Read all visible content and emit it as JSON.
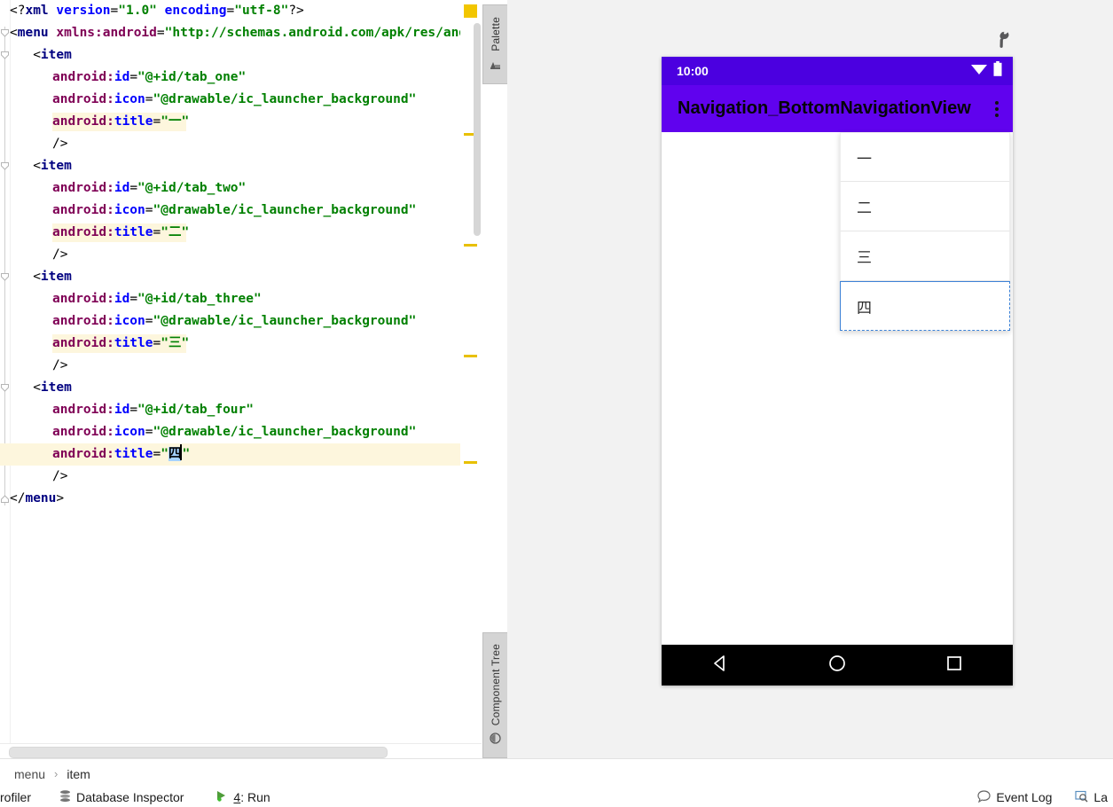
{
  "editor": {
    "lines": [
      {
        "id": "l1",
        "tokens": [
          {
            "t": "punc",
            "s": "<?"
          },
          {
            "t": "proc",
            "s": "xml"
          },
          {
            "t": "punc",
            "s": " "
          },
          {
            "t": "attr2",
            "s": "version"
          },
          {
            "t": "punc",
            "s": "="
          },
          {
            "t": "val",
            "s": "\"1.0\""
          },
          {
            "t": "punc",
            "s": " "
          },
          {
            "t": "attr2",
            "s": "encoding"
          },
          {
            "t": "punc",
            "s": "="
          },
          {
            "t": "val",
            "s": "\"utf-8\""
          },
          {
            "t": "punc",
            "s": "?>"
          }
        ],
        "indent": 0,
        "highlight": false
      },
      {
        "id": "l2",
        "tokens": [
          {
            "t": "punc",
            "s": "<"
          },
          {
            "t": "tag",
            "s": "menu"
          },
          {
            "t": "punc",
            "s": " "
          },
          {
            "t": "attr",
            "s": "xmlns:android"
          },
          {
            "t": "punc",
            "s": "="
          },
          {
            "t": "val",
            "s": "\"http://schemas.android.com/apk/res/and"
          }
        ],
        "indent": 0,
        "highlight": false
      },
      {
        "id": "l3",
        "tokens": [
          {
            "t": "punc",
            "s": "<"
          },
          {
            "t": "tag",
            "s": "item"
          }
        ],
        "indent": 3,
        "highlight": false
      },
      {
        "id": "l4",
        "tokens": [
          {
            "t": "attr",
            "s": "android:"
          },
          {
            "t": "attr2",
            "s": "id"
          },
          {
            "t": "punc",
            "s": "="
          },
          {
            "t": "val",
            "s": "\"@+id/tab_one\""
          }
        ],
        "indent": 5.5,
        "highlight": false
      },
      {
        "id": "l5",
        "tokens": [
          {
            "t": "attr",
            "s": "android:"
          },
          {
            "t": "attr2",
            "s": "icon"
          },
          {
            "t": "punc",
            "s": "="
          },
          {
            "t": "val",
            "s": "\"@drawable/ic_launcher_background\""
          }
        ],
        "indent": 5.5,
        "highlight": false
      },
      {
        "id": "l6",
        "tokens": [
          {
            "t": "attr",
            "s": "android:"
          },
          {
            "t": "attr2",
            "s": "title"
          },
          {
            "t": "punc",
            "s": "="
          },
          {
            "t": "val",
            "s": "\"一\""
          }
        ],
        "indent": 5.5,
        "highlight": true
      },
      {
        "id": "l7",
        "tokens": [
          {
            "t": "punc",
            "s": "/>"
          }
        ],
        "indent": 5.5,
        "highlight": false
      },
      {
        "id": "l8",
        "tokens": [
          {
            "t": "punc",
            "s": "<"
          },
          {
            "t": "tag",
            "s": "item"
          }
        ],
        "indent": 3,
        "highlight": false
      },
      {
        "id": "l9",
        "tokens": [
          {
            "t": "attr",
            "s": "android:"
          },
          {
            "t": "attr2",
            "s": "id"
          },
          {
            "t": "punc",
            "s": "="
          },
          {
            "t": "val",
            "s": "\"@+id/tab_two\""
          }
        ],
        "indent": 5.5,
        "highlight": false
      },
      {
        "id": "l10",
        "tokens": [
          {
            "t": "attr",
            "s": "android:"
          },
          {
            "t": "attr2",
            "s": "icon"
          },
          {
            "t": "punc",
            "s": "="
          },
          {
            "t": "val",
            "s": "\"@drawable/ic_launcher_background\""
          }
        ],
        "indent": 5.5,
        "highlight": false
      },
      {
        "id": "l11",
        "tokens": [
          {
            "t": "attr",
            "s": "android:"
          },
          {
            "t": "attr2",
            "s": "title"
          },
          {
            "t": "punc",
            "s": "="
          },
          {
            "t": "val",
            "s": "\"二\""
          }
        ],
        "indent": 5.5,
        "highlight": true
      },
      {
        "id": "l12",
        "tokens": [
          {
            "t": "punc",
            "s": "/>"
          }
        ],
        "indent": 5.5,
        "highlight": false
      },
      {
        "id": "l13",
        "tokens": [
          {
            "t": "punc",
            "s": "<"
          },
          {
            "t": "tag",
            "s": "item"
          }
        ],
        "indent": 3,
        "highlight": false
      },
      {
        "id": "l14",
        "tokens": [
          {
            "t": "attr",
            "s": "android:"
          },
          {
            "t": "attr2",
            "s": "id"
          },
          {
            "t": "punc",
            "s": "="
          },
          {
            "t": "val",
            "s": "\"@+id/tab_three\""
          }
        ],
        "indent": 5.5,
        "highlight": false
      },
      {
        "id": "l15",
        "tokens": [
          {
            "t": "attr",
            "s": "android:"
          },
          {
            "t": "attr2",
            "s": "icon"
          },
          {
            "t": "punc",
            "s": "="
          },
          {
            "t": "val",
            "s": "\"@drawable/ic_launcher_background\""
          }
        ],
        "indent": 5.5,
        "highlight": false
      },
      {
        "id": "l16",
        "tokens": [
          {
            "t": "attr",
            "s": "android:"
          },
          {
            "t": "attr2",
            "s": "title"
          },
          {
            "t": "punc",
            "s": "="
          },
          {
            "t": "val",
            "s": "\"三\""
          }
        ],
        "indent": 5.5,
        "highlight": true
      },
      {
        "id": "l17",
        "tokens": [
          {
            "t": "punc",
            "s": "/>"
          }
        ],
        "indent": 5.5,
        "highlight": false
      },
      {
        "id": "l18",
        "tokens": [
          {
            "t": "punc",
            "s": "<"
          },
          {
            "t": "tag",
            "s": "item"
          }
        ],
        "indent": 3,
        "highlight": false
      },
      {
        "id": "l19",
        "tokens": [
          {
            "t": "attr",
            "s": "android:"
          },
          {
            "t": "attr2",
            "s": "id"
          },
          {
            "t": "punc",
            "s": "="
          },
          {
            "t": "val",
            "s": "\"@+id/tab_four\""
          }
        ],
        "indent": 5.5,
        "highlight": false
      },
      {
        "id": "l20",
        "tokens": [
          {
            "t": "attr",
            "s": "android:"
          },
          {
            "t": "attr2",
            "s": "icon"
          },
          {
            "t": "punc",
            "s": "="
          },
          {
            "t": "val",
            "s": "\"@drawable/ic_launcher_background\""
          }
        ],
        "indent": 5.5,
        "highlight": false
      },
      {
        "id": "l21",
        "tokens": [
          {
            "t": "attr",
            "s": "android:"
          },
          {
            "t": "attr2",
            "s": "title"
          },
          {
            "t": "punc",
            "s": "="
          },
          {
            "t": "val",
            "s": "\""
          },
          {
            "t": "sel",
            "s": "四"
          },
          {
            "t": "caret",
            "s": ""
          },
          {
            "t": "val",
            "s": "\""
          }
        ],
        "indent": 5.5,
        "highlight": false,
        "caretline": true
      },
      {
        "id": "l22",
        "tokens": [
          {
            "t": "punc",
            "s": "/>"
          }
        ],
        "indent": 5.5,
        "highlight": false
      },
      {
        "id": "l23",
        "tokens": [
          {
            "t": "punc",
            "s": "</"
          },
          {
            "t": "tag",
            "s": "menu"
          },
          {
            "t": "punc",
            "s": ">"
          }
        ],
        "indent": 0,
        "highlight": false
      }
    ],
    "stripe_marks_y": [
      150,
      275,
      400,
      520
    ]
  },
  "tool_tabs": [
    {
      "id": "palette",
      "label": "Palette",
      "icon": "palette-icon"
    },
    {
      "id": "component-tree",
      "label": "Component Tree",
      "icon": "component-tree-icon"
    }
  ],
  "preview": {
    "wrench_icon": "wrench-icon",
    "device": {
      "status_bar": {
        "time": "10:00",
        "wifi_icon": "wifi-icon",
        "battery_icon": "battery-icon"
      },
      "app_bar": {
        "title": "Navigation_BottomNavigationView",
        "overflow_icon": "overflow-menu-icon"
      },
      "dropdown": {
        "items": [
          {
            "label": "一",
            "selected": false
          },
          {
            "label": "二",
            "selected": false
          },
          {
            "label": "三",
            "selected": false
          },
          {
            "label": "四",
            "selected": true
          }
        ]
      },
      "nav_bar": {
        "back_icon": "back-triangle-icon",
        "home_icon": "home-circle-icon",
        "recents_icon": "recents-square-icon"
      }
    }
  },
  "breadcrumb": {
    "items": [
      "menu",
      "item"
    ],
    "separator": "›"
  },
  "status_bar": {
    "left_items": [
      {
        "id": "profiler",
        "label": "rofiler",
        "icon": ""
      },
      {
        "id": "database-inspector",
        "label": "Database Inspector",
        "icon": "database-icon"
      },
      {
        "id": "run",
        "label_prefix": "4",
        "label": ": Run",
        "icon": "run-icon"
      }
    ],
    "right_items": [
      {
        "id": "event-log",
        "label": "Event Log",
        "icon": "event-log-icon"
      },
      {
        "id": "layout-inspector",
        "label": "La",
        "icon": "layout-inspector-icon"
      }
    ]
  },
  "colors": {
    "android_status_purple": "#4b00e0",
    "android_appbar_purple": "#6002ee",
    "selection_blue": "#3d82d6",
    "highlight_yellow": "#fdf6dd",
    "stripe_warning": "#e8c000"
  }
}
